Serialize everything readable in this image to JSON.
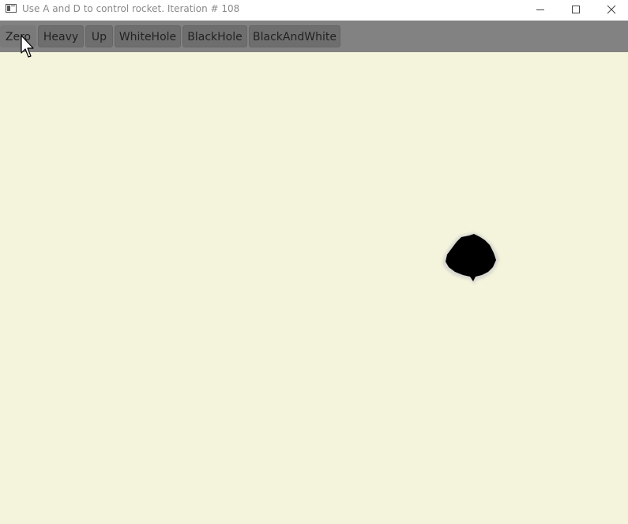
{
  "window": {
    "title": "Use A and D to control rocket. Iteration # 108",
    "controls": {
      "minimize_icon": "minimize-icon",
      "maximize_icon": "maximize-icon",
      "close_icon": "close-icon"
    }
  },
  "toolbar": {
    "buttons": [
      {
        "label": "Zero"
      },
      {
        "label": "Heavy"
      },
      {
        "label": "Up"
      },
      {
        "label": "WhiteHole"
      },
      {
        "label": "BlackHole"
      },
      {
        "label": "BlackAndWhite"
      }
    ]
  },
  "canvas": {
    "background_color": "#f4f4dc",
    "object_icon": "black-blob-icon",
    "object_color": "#000000"
  },
  "cursor": {
    "icon": "mouse-pointer-icon"
  }
}
